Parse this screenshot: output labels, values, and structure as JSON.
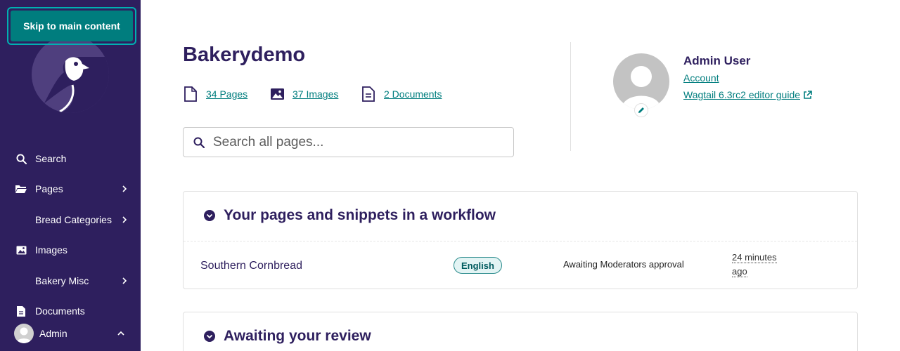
{
  "skip_link": {
    "label": "Skip to main content"
  },
  "sidebar": {
    "items": [
      {
        "label": "Search",
        "icon": "search-icon"
      },
      {
        "label": "Pages",
        "icon": "folder-open-icon",
        "has_children": true
      },
      {
        "label": "Bread Categories",
        "icon": "",
        "has_children": true
      },
      {
        "label": "Images",
        "icon": "image-icon"
      },
      {
        "label": "Bakery Misc",
        "icon": "",
        "has_children": true
      },
      {
        "label": "Documents",
        "icon": "document-icon"
      }
    ],
    "account": {
      "label": "Admin",
      "icon": "chevron-up-icon"
    }
  },
  "main": {
    "site_title": "Bakerydemo",
    "stats": [
      {
        "label": "34 Pages",
        "icon": "page-icon"
      },
      {
        "label": "37 Images",
        "icon": "image-icon"
      },
      {
        "label": "2 Documents",
        "icon": "document-icon"
      }
    ],
    "search": {
      "placeholder": "Search all pages..."
    }
  },
  "user": {
    "name": "Admin User",
    "account_link": "Account",
    "guide_link": "Wagtail 6.3rc2 editor guide"
  },
  "panels": {
    "workflow": {
      "title": "Your pages and snippets in a workflow",
      "rows": [
        {
          "title": "Southern Cornbread",
          "locale": "English",
          "status": "Awaiting Moderators approval",
          "time_line1": "24 minutes",
          "time_line2": "ago"
        }
      ]
    },
    "review": {
      "title": "Awaiting your review"
    }
  },
  "colors": {
    "sidebar_bg": "#2e1f5e",
    "accent_teal": "#007d7e",
    "text_primary": "#2e1f5e"
  }
}
